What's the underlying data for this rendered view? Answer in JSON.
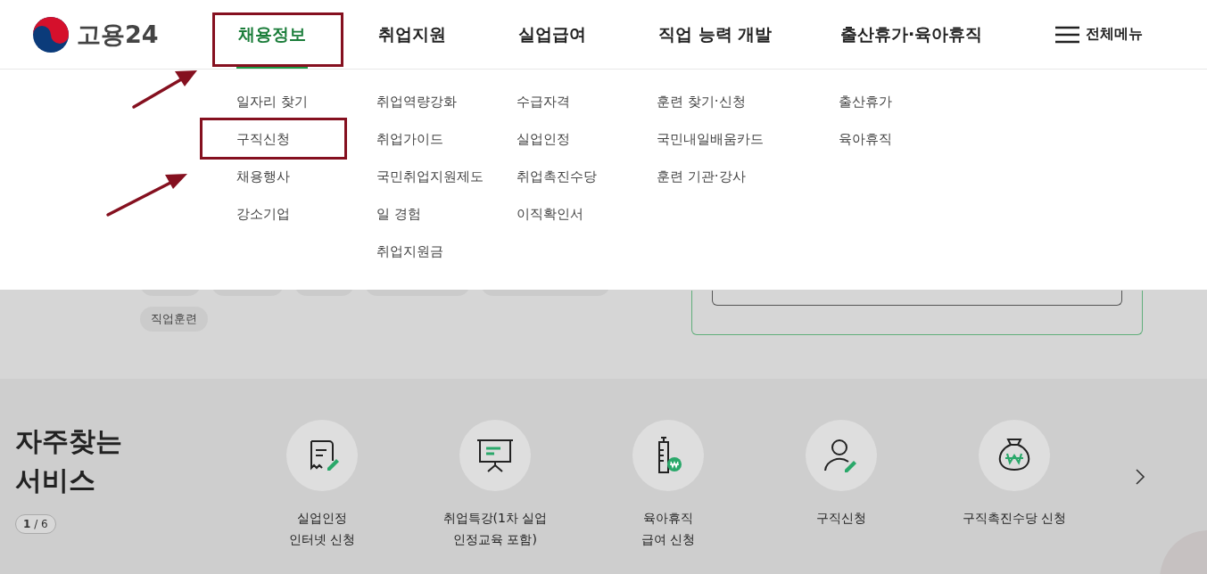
{
  "header": {
    "logo": "고용24",
    "nav": [
      {
        "label": "채용정보",
        "selected": true
      },
      {
        "label": "취업지원",
        "selected": false
      },
      {
        "label": "실업급여",
        "selected": false
      },
      {
        "label": "직업 능력 개발",
        "selected": false
      },
      {
        "label": "출산휴가·육아휴직",
        "selected": false
      }
    ],
    "menu_button": "전체메뉴"
  },
  "mega_menu": {
    "columns": [
      [
        "일자리 찾기",
        "구직신청",
        "채용행사",
        "강소기업"
      ],
      [
        "취업역량강화",
        "취업가이드",
        "국민취업지원제도",
        "일 경험",
        "취업지원금"
      ],
      [
        "수급자격",
        "실업인정",
        "취업촉진수당",
        "이직확인서"
      ],
      [
        "훈련 찾기·신청",
        "국민내일배움카드",
        "훈련 기관·강사"
      ],
      [
        "출산휴가",
        "육아휴직"
      ]
    ]
  },
  "background": {
    "tags": [
      "직업훈련"
    ]
  },
  "services": {
    "title": "자주찾는 서비스",
    "pager": "**1** / 6",
    "items": [
      {
        "kind": "receipt",
        "label": "실업인정\n인터넷 신청"
      },
      {
        "kind": "lecture",
        "label": "취업특강(1차 실업\n인정교육 포함)"
      },
      {
        "kind": "bottle",
        "label": "육아휴직\n급여 신청"
      },
      {
        "kind": "person",
        "label": "구직신청"
      },
      {
        "kind": "moneybag",
        "label": "구직촉진수당 신청"
      }
    ]
  }
}
